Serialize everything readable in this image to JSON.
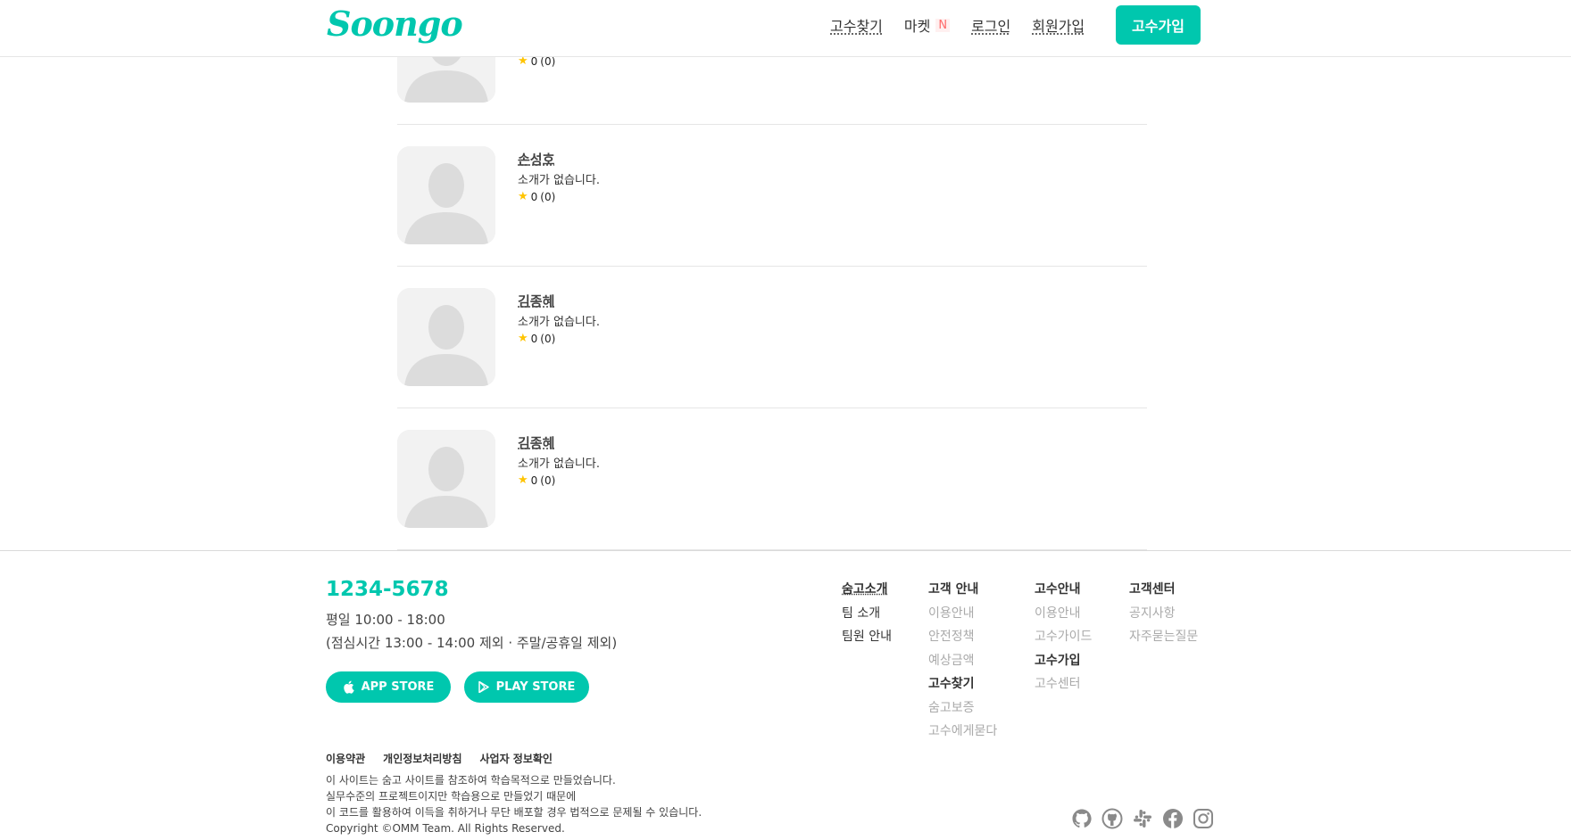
{
  "header": {
    "logo": "Soongo",
    "nav": {
      "find_pro": "고수찾기",
      "market": "마켓",
      "market_badge": "N",
      "login": "로그인",
      "signup": "회원가입"
    },
    "pro_signup_button": "고수가입"
  },
  "profiles": [
    {
      "name": "",
      "intro": "",
      "rating": "0",
      "count": "(0)"
    },
    {
      "name": "손성호",
      "intro": "소개가 없습니다.",
      "rating": "0",
      "count": "(0)"
    },
    {
      "name": "김종혜",
      "intro": "소개가 없습니다.",
      "rating": "0",
      "count": "(0)"
    },
    {
      "name": "김종혜",
      "intro": "소개가 없습니다.",
      "rating": "0",
      "count": "(0)"
    }
  ],
  "footer": {
    "phone": "1234-5678",
    "hours": "평일 10:00 - 18:00",
    "hours_note": "(점심시간 13:00 - 14:00 제외 · 주말/공휴일 제외)",
    "app_store": "APP STORE",
    "play_store": "PLAY STORE",
    "col1": {
      "items": [
        "숨고소개",
        "팀 소개",
        "팀원 안내"
      ]
    },
    "col2": {
      "header": "고객 안내",
      "items": [
        "이용안내",
        "안전정책",
        "예상금액"
      ],
      "bold_item": "고수찾기",
      "items2": [
        "숨고보증",
        "고수에게묻다"
      ]
    },
    "col3": {
      "header": "고수안내",
      "items": [
        "이용안내",
        "고수가이드"
      ],
      "bold_item": "고수가입",
      "items2": [
        "고수센터"
      ]
    },
    "col4": {
      "header": "고객센터",
      "items": [
        "공지사항",
        "자주묻는질문"
      ]
    },
    "legal": {
      "terms": "이용약관",
      "privacy": "개인정보처리방침",
      "business": "사업자 정보확인"
    },
    "notice": [
      "이 사이트는 숨고 사이트를 참조하여 학습목적으로 만들었습니다.",
      "실무수준의 프로젝트이지만 학습용으로 만들었기 때문에",
      "이 코드를 활용하여 이득을 취하거나 무단 배포할 경우 법적으로 문제될 수 있습니다.",
      "Copyright ©OMM Team. All Rights Reserved."
    ],
    "socials": [
      "github-icon",
      "github-alt-icon",
      "slack-icon",
      "facebook-icon",
      "instagram-icon"
    ]
  },
  "colors": {
    "accent": "#00c7ae",
    "star": "#ffc400",
    "badge": "#ff6b6b"
  }
}
